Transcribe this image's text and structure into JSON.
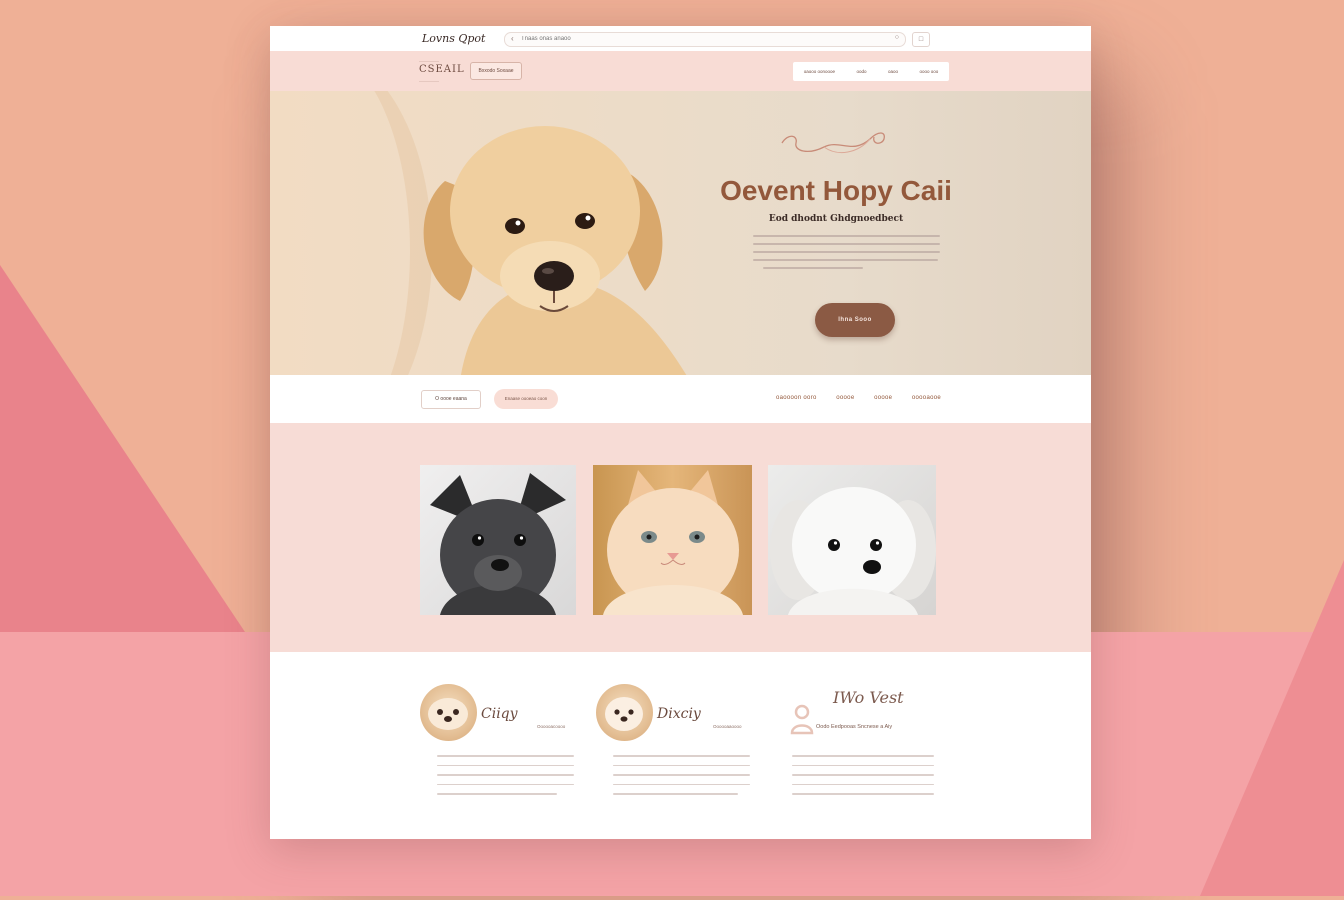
{
  "topbar": {
    "brand": "Lovns Qpot",
    "search_placeholder": "Tnaas onas anaoo"
  },
  "subnav": {
    "logo": "CSEAIL",
    "button_label": "Bxxodo Soxaae",
    "right_items": [
      "oaooo oonoooe",
      "oodo",
      "oaoo",
      "oooo ooo"
    ]
  },
  "hero": {
    "title": "Oevent Hopy Caii",
    "subtitle": "Eod dhodnt Ghdgnoedbect",
    "cta_label": "Ihna Sooo"
  },
  "filterbar": {
    "pill_a": "O oooe eaana",
    "pill_b": "Enaase oooeao coon",
    "links": [
      "oaoooon ooro",
      "ooooe",
      "ooooe",
      "ooooaooe"
    ]
  },
  "features": [
    {
      "title": "Ciiqy",
      "tag": "Oooooacoooo"
    },
    {
      "title": "Dixciy",
      "tag": "Oooooaaoooo"
    },
    {
      "title": "IWo Vest",
      "tag": "Oodo Eedpooas Sncnese a Aiy"
    }
  ],
  "colors": {
    "accent": "#93583b",
    "cta": "#8b5a44",
    "pink_panel": "#f7dcd6",
    "backdrop": "#efb096"
  }
}
